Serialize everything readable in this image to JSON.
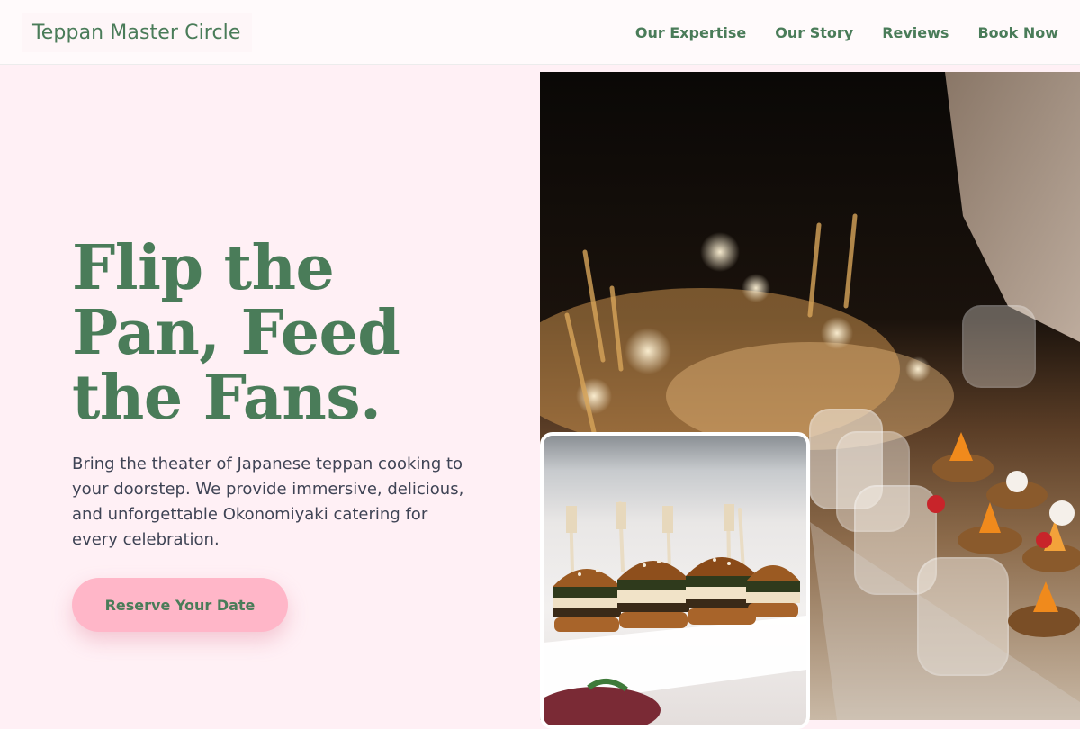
{
  "header": {
    "logo": "Teppan Master Circle",
    "nav": [
      {
        "label": "Our Expertise"
      },
      {
        "label": "Our Story"
      },
      {
        "label": "Reviews"
      },
      {
        "label": "Book Now"
      }
    ]
  },
  "hero": {
    "title": "Flip the Pan, Feed the Fans.",
    "subtitle": "Bring the theater of Japanese teppan cooking to your doorstep. We provide immersive, delicious, and unforgettable Okonomiyaki catering for every celebration.",
    "cta_label": "Reserve Your Date"
  },
  "colors": {
    "brand_green": "#4a7c59",
    "background_pink": "#fff0f5",
    "cta_pink": "#ffb6c8"
  }
}
